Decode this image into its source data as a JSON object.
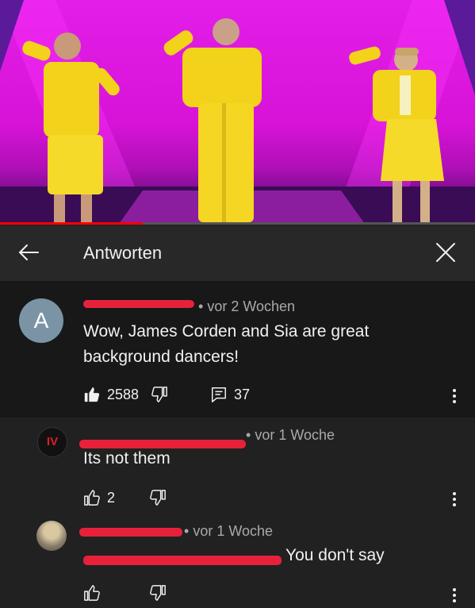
{
  "header": {
    "title": "Antworten"
  },
  "progress": {
    "played_fraction": 0.3
  },
  "main_comment": {
    "avatar_letter": "A",
    "time": "vor 2 Wochen",
    "text_line1": "Wow, James Corden and Sia are great",
    "text_line2": "background dancers!",
    "likes": "2588",
    "replies": "37"
  },
  "replies": [
    {
      "avatar_text": "IV",
      "time": "vor 1 Woche",
      "text": "Its not them",
      "likes": "2"
    },
    {
      "time": "vor 1 Woche",
      "text": "You don't say",
      "likes": ""
    }
  ],
  "colors": {
    "background": "#212121",
    "header": "#282828",
    "highlighted": "#181818",
    "scribble": "#e8213a",
    "link": "#3ea6ff",
    "stage": "#e21ee8"
  },
  "icons": [
    "back-arrow-icon",
    "close-icon",
    "thumb-up-icon",
    "thumb-down-icon",
    "reply-icon",
    "more-vert-icon"
  ]
}
